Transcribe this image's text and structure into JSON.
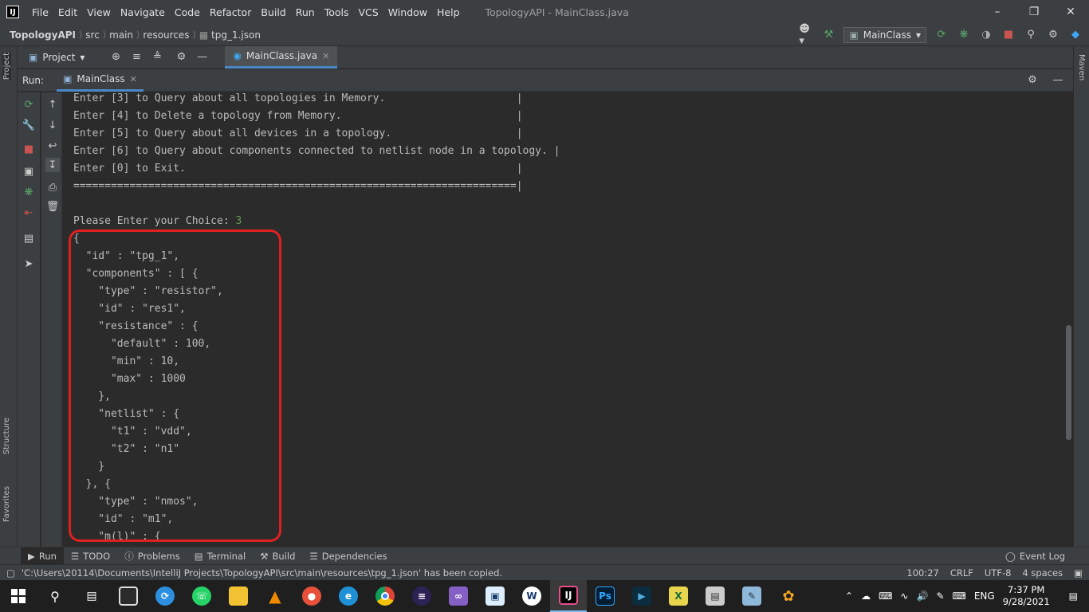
{
  "menubar": {
    "items": [
      "File",
      "Edit",
      "View",
      "Navigate",
      "Code",
      "Refactor",
      "Build",
      "Run",
      "Tools",
      "VCS",
      "Window",
      "Help"
    ],
    "window_title": "TopologyAPI - MainClass.java"
  },
  "navbar": {
    "breadcrumbs": [
      "TopologyAPI",
      "src",
      "main",
      "resources",
      "tpg_1.json"
    ],
    "run_config": "MainClass"
  },
  "toolrow": {
    "project_tab": "Project",
    "editor_tab": "MainClass.java"
  },
  "run_panel": {
    "label": "Run:",
    "tab": "MainClass"
  },
  "side_tabs": {
    "left_top": "Project",
    "left_structure": "Structure",
    "left_favorites": "Favorites",
    "right": "Maven"
  },
  "console": {
    "lines": [
      "Enter [3] to Query about all topologies in Memory.                     |",
      "Enter [4] to Delete a topology from Memory.                            |",
      "Enter [5] to Query about all devices in a topology.                    |",
      "Enter [6] to Query about components connected to netlist node in a topology. |",
      "Enter [0] to Exit.                                                     |",
      "=======================================================================|",
      "",
      "Please Enter your Choice: ",
      "{",
      "  \"id\" : \"tpg_1\",",
      "  \"components\" : [ {",
      "    \"type\" : \"resistor\",",
      "    \"id\" : \"res1\",",
      "    \"resistance\" : {",
      "      \"default\" : 100,",
      "      \"min\" : 10,",
      "      \"max\" : 1000",
      "    },",
      "    \"netlist\" : {",
      "      \"t1\" : \"vdd\",",
      "      \"t2\" : \"n1\"",
      "    }",
      "  }, {",
      "    \"type\" : \"nmos\",",
      "    \"id\" : \"m1\",",
      "    \"m(l)\" : {"
    ],
    "user_input": "3"
  },
  "bottom_tabs": [
    "Run",
    "TODO",
    "Problems",
    "Terminal",
    "Build",
    "Dependencies"
  ],
  "event_log": "Event Log",
  "statusbar": {
    "message": "'C:\\Users\\20114\\Documents\\IntelliJ Projects\\TopologyAPI\\src\\main\\resources\\tpg_1.json' has been copied.",
    "position": "100:27",
    "line_sep": "CRLF",
    "encoding": "UTF-8",
    "indent": "4 spaces"
  },
  "taskbar": {
    "lang": "ENG",
    "time": "7:37 PM",
    "date": "9/28/2021"
  },
  "colors": {
    "highlight_border": "#e02020",
    "accent": "#4a88c7",
    "user_input": "#629755"
  }
}
